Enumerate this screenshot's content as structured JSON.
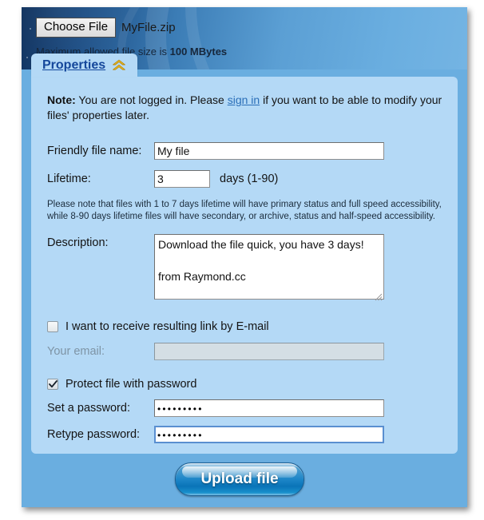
{
  "header": {
    "choose_file_button": "Choose File",
    "file_name": "MyFile.zip",
    "max_size_prefix": "Maximum allowed file size is ",
    "max_size_value": "100 MBytes"
  },
  "tab": {
    "label": "Properties",
    "collapse_icon": "double-chevron-up-icon"
  },
  "note": {
    "bold_prefix": "Note:",
    "text_before_link": " You are not logged in. Please ",
    "link_text": "sign in",
    "text_after_link": " if you want to be able to modify your files' properties later."
  },
  "form": {
    "friendly_name": {
      "label": "Friendly file name:",
      "value": "My file",
      "placeholder": ""
    },
    "lifetime": {
      "label": "Lifetime:",
      "value": "3",
      "hint": "days (1-90)",
      "placeholder": ""
    },
    "lifetime_note": "Please note that files with 1 to 7 days lifetime will have primary status and full speed accessibility, while 8-90 days lifetime files will have secondary, or archive, status and half-speed accessibility.",
    "description": {
      "label": "Description:",
      "value": "Download the file quick, you have 3 days!\n\nfrom Raymond.cc",
      "placeholder": ""
    },
    "email_checkbox": {
      "label": "I want to receive resulting link by E-mail",
      "checked": false
    },
    "email": {
      "label": "Your email:",
      "value": "",
      "placeholder": "",
      "disabled": true
    },
    "password_checkbox": {
      "label": "Protect file with password",
      "checked": true
    },
    "set_password": {
      "label": "Set a password:",
      "value": "•••••••••",
      "placeholder": ""
    },
    "retype_password": {
      "label": "Retype password:",
      "value": "•••••••••",
      "placeholder": ""
    }
  },
  "footer": {
    "upload_button": "Upload file"
  },
  "colors": {
    "panel_background": "#b4d9f6",
    "window_background": "#6aaee0",
    "header_dark": "#0d2f5c",
    "link_blue": "#2b6fb8",
    "tab_link": "#15479b",
    "chevron_gold": "#f5c11e",
    "upload_blue": "#1d86c8"
  }
}
